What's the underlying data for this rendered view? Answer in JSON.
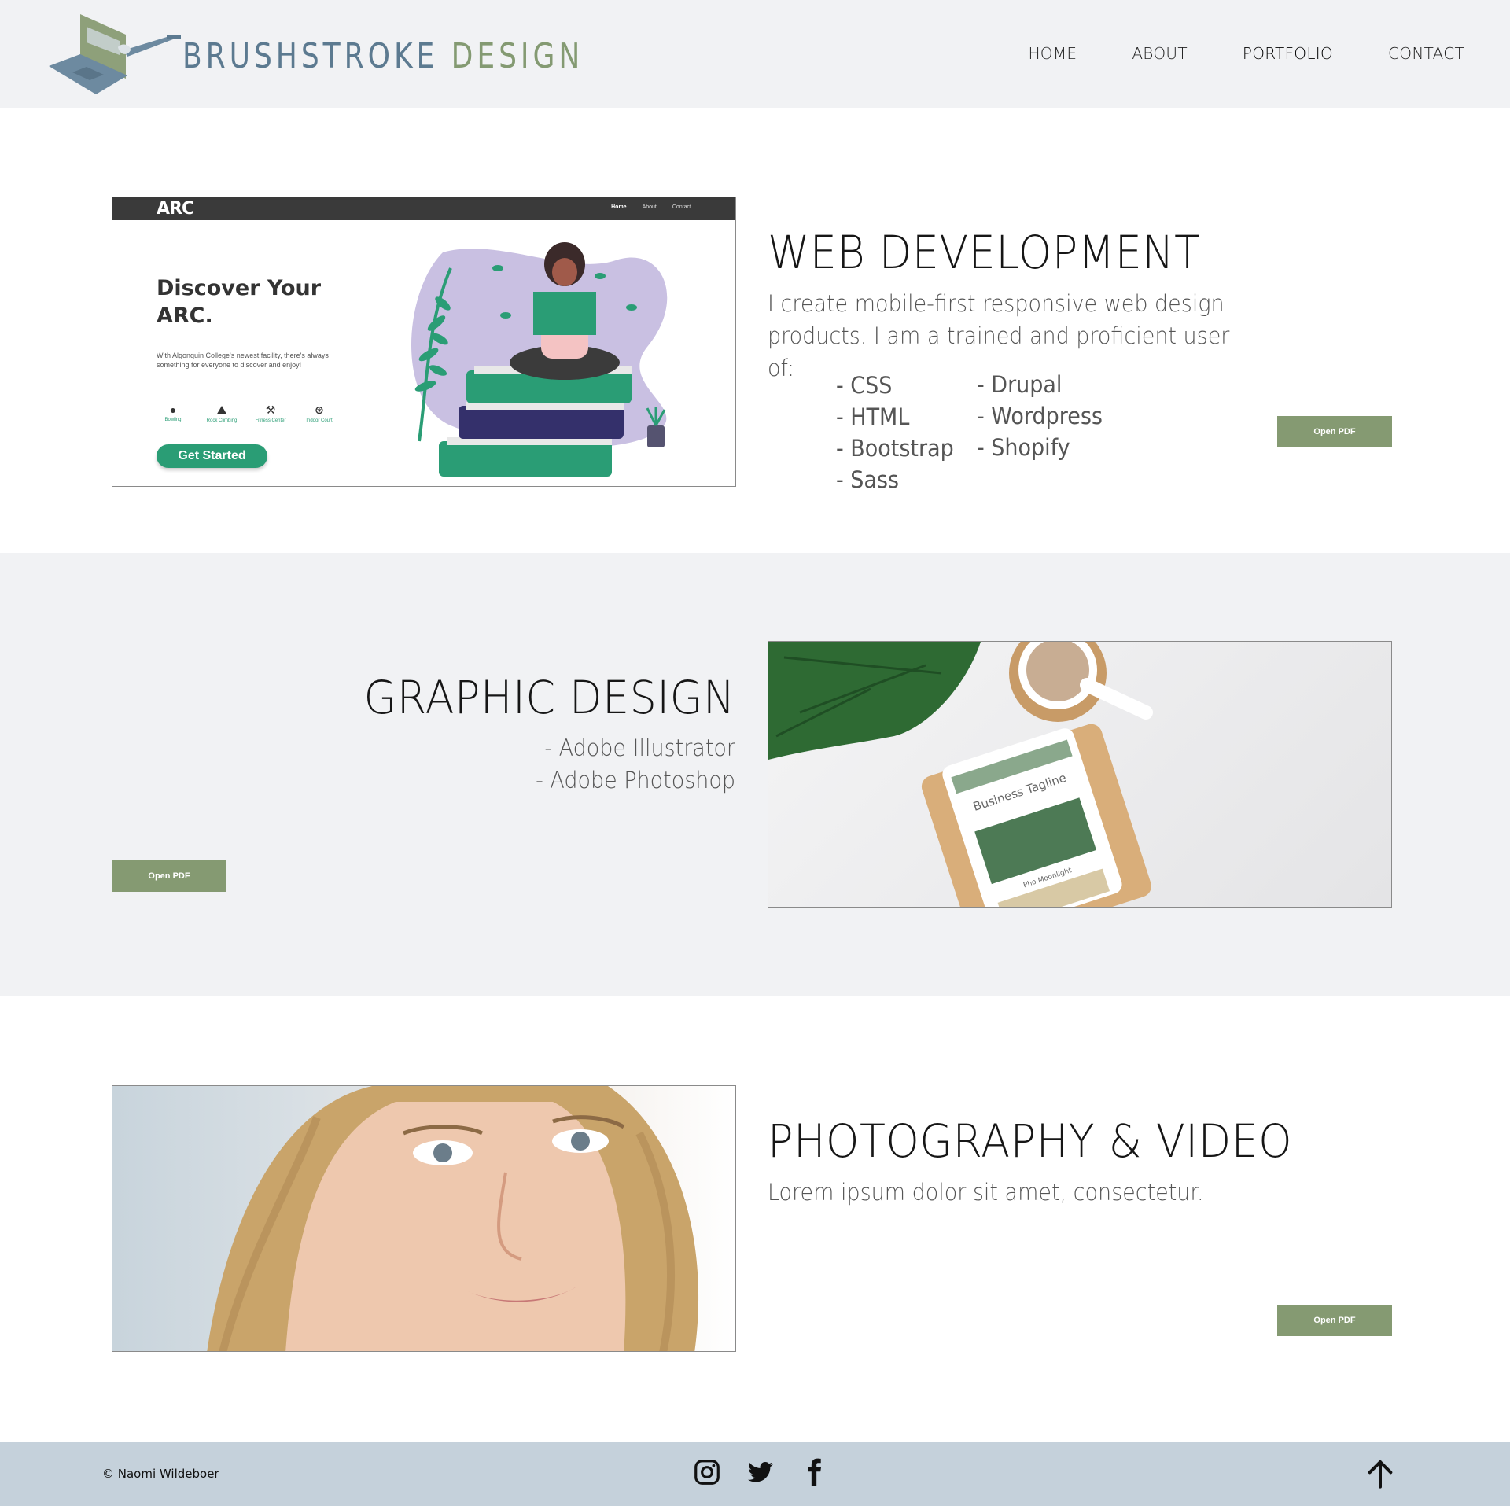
{
  "brand": {
    "word1": "BRUSHSTROKE",
    "word2": "DESIGN"
  },
  "nav": [
    {
      "label": "HOME"
    },
    {
      "label": "ABOUT"
    },
    {
      "label": "PORTFOLIO",
      "active": true
    },
    {
      "label": "CONTACT"
    }
  ],
  "web": {
    "title": "WEB DEVELOPMENT",
    "description": "I create mobile-first responsive web design products. I am a trained and proficient user of:",
    "skills_col1": [
      "- CSS",
      "- HTML",
      "- Bootstrap",
      "- Sass"
    ],
    "skills_col2": [
      "- Drupal",
      "- Wordpress",
      "- Shopify"
    ],
    "button": "Open PDF",
    "preview": {
      "logo": "ARC",
      "links": [
        "Home",
        "About",
        "Contact"
      ],
      "headline_1": "Discover Your",
      "headline_2": "ARC.",
      "paragraph": "With Algonquin College's newest facility, there's always something for everyone to discover and enjoy!",
      "icons": [
        "Bowling",
        "Rock Climbing",
        "Fitness Center",
        "Indoor Court"
      ],
      "cta": "Get Started"
    }
  },
  "graphic": {
    "title": "GRAPHIC DESIGN",
    "items": [
      "- Adobe Illustrator",
      "- Adobe Photoshop"
    ],
    "button": "Open PDF",
    "preview": {
      "tagline": "Business Tagline",
      "caption": "Pho Moonlight"
    }
  },
  "photo": {
    "title": "PHOTOGRAPHY & VIDEO",
    "description": "Lorem ipsum dolor sit amet, consectetur.",
    "button": "Open PDF"
  },
  "footer": {
    "copyright": "© Naomi Wildeboer",
    "socials": [
      "instagram-icon",
      "twitter-icon",
      "facebook-icon"
    ]
  },
  "colors": {
    "accent": "#859a72",
    "header_bg": "#f1f2f4",
    "footer_bg": "#c5d1db",
    "logo_blue": "#5c7a90"
  }
}
